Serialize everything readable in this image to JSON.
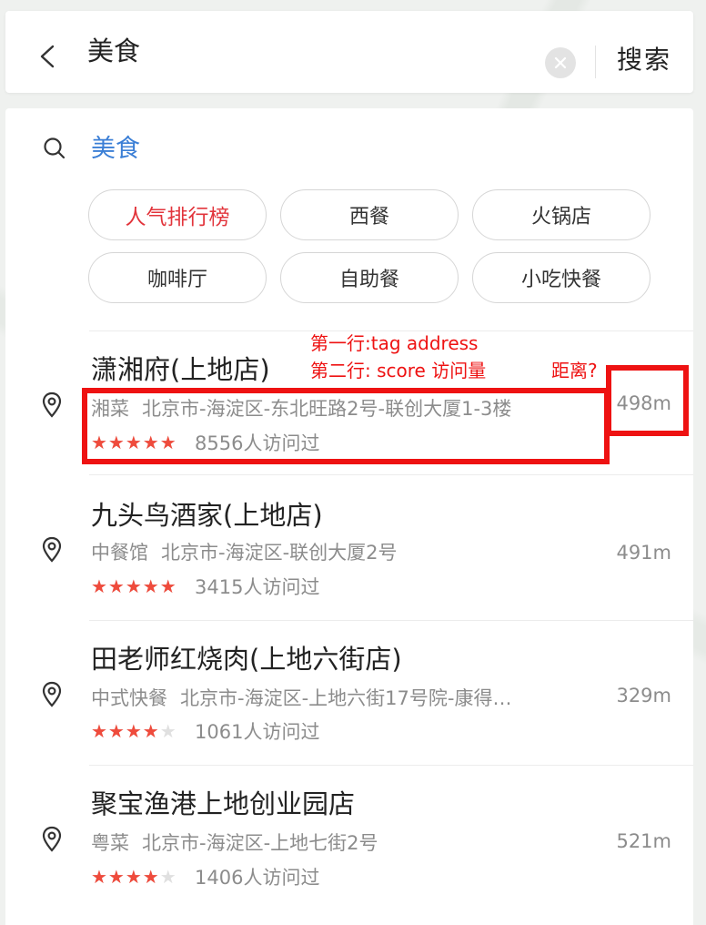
{
  "search": {
    "query": "美食",
    "button_label": "搜索"
  },
  "suggestion": {
    "text": "美食"
  },
  "chips": [
    "人气排行榜",
    "西餐",
    "火锅店",
    "咖啡厅",
    "自助餐",
    "小吃快餐"
  ],
  "results": [
    {
      "name": "潇湘府(上地店)",
      "tag": "湘菜",
      "address": "北京市-海淀区-东北旺路2号-联创大厦1-3楼",
      "rating": 4.5,
      "visits": "8556人访问过",
      "distance": "498m"
    },
    {
      "name": "九头鸟酒家(上地店)",
      "tag": "中餐馆",
      "address": "北京市-海淀区-联创大厦2号",
      "rating": 4.5,
      "visits": "3415人访问过",
      "distance": "491m"
    },
    {
      "name": "田老师红烧肉(上地六街店)",
      "tag": "中式快餐",
      "address": "北京市-海淀区-上地六街17号院-康得…",
      "rating": 3.5,
      "visits": "1061人访问过",
      "distance": "329m"
    },
    {
      "name": "聚宝渔港上地创业园店",
      "tag": "粤菜",
      "address": "北京市-海淀区-上地七街2号",
      "rating": 3.5,
      "visits": "1406人访问过",
      "distance": "521m"
    }
  ],
  "annotations": {
    "line1": "第一行:tag  address",
    "line2": "第二行: score 访问量",
    "distance_q": "距离?"
  },
  "colors": {
    "accent": "#3b7fd6",
    "hot": "#e2353c",
    "star": "#ef4b3c",
    "annotation": "#ee1212"
  }
}
